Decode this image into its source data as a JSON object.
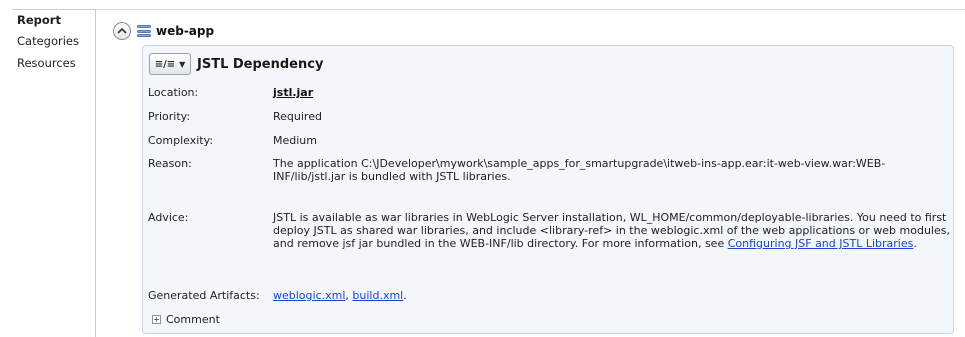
{
  "tabs": [
    {
      "label": "Report"
    },
    {
      "label": "Categories"
    },
    {
      "label": "Resources"
    }
  ],
  "header": {
    "collapse_icon": "chevron-up-icon",
    "app_icon": "stack-icon",
    "app_name": "web-app"
  },
  "issue": {
    "toolbar_icon": "view-mode-dropdown-icon",
    "toolbar_glyph": "≡/≡",
    "title": "JSTL Dependency",
    "fields": {
      "location_label": "Location:",
      "location_value": "jstl.jar",
      "priority_label": "Priority:",
      "priority_value": "Required",
      "complexity_label": "Complexity:",
      "complexity_value": "Medium",
      "reason_label": "Reason:",
      "reason_value": "The application C:\\JDeveloper\\mywork\\sample_apps_for_smartupgrade\\itweb-ins-app.ear:it-web-view.war:WEB-INF/lib/jstl.jar is bundled with JSTL libraries.",
      "advice_label": "Advice:",
      "advice_text": "JSTL is available as war libraries in WebLogic Server installation, WL_HOME/common/deployable-libraries. You need to first deploy JSTL as shared war libraries, and include <library-ref> in the weblogic.xml of the web applications or web modules, and remove jsf jar bundled in the WEB-INF/lib directory. For more information, see ",
      "advice_link": "Configuring JSF and JSTL Libraries",
      "advice_end": ".",
      "artifacts_label": "Generated Artifacts:",
      "artifact_1": "weblogic.xml",
      "artifact_sep": ", ",
      "artifact_2": "build.xml",
      "artifact_end": "."
    },
    "comment_label": "Comment",
    "comment_icon": "expand-plus-icon"
  }
}
